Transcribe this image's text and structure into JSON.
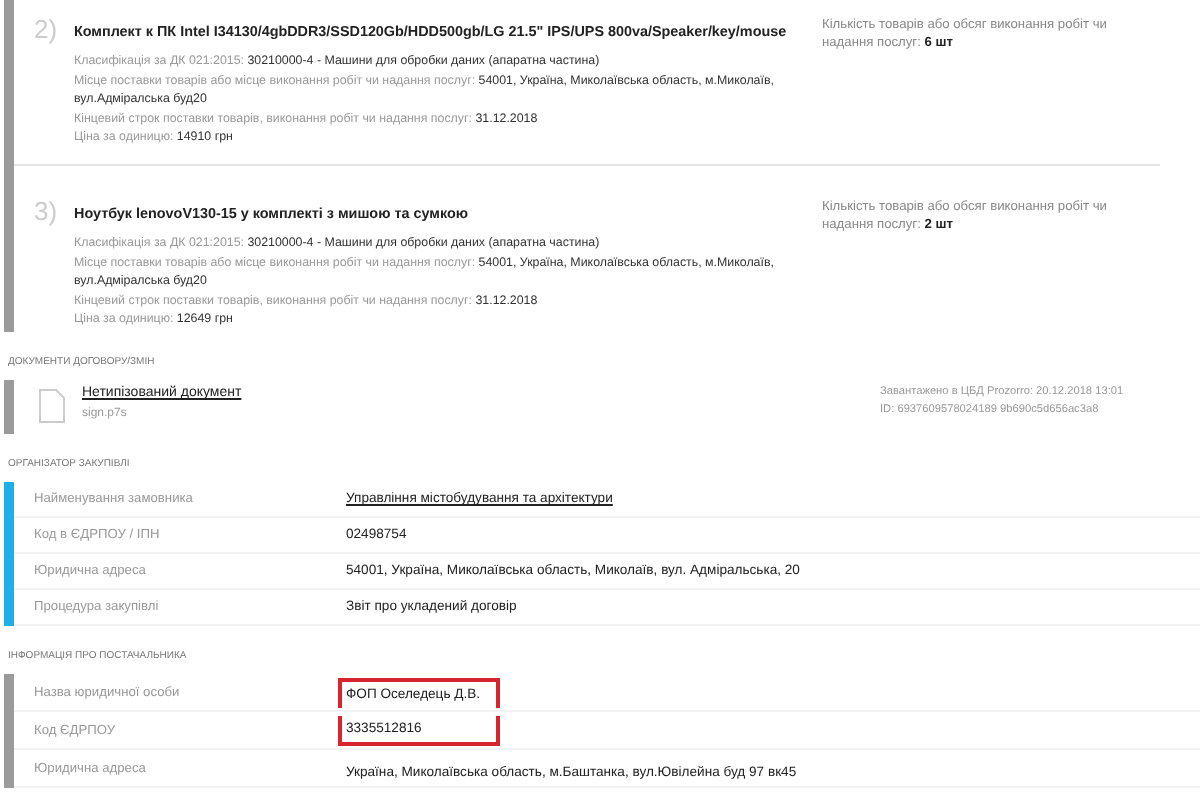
{
  "items": [
    {
      "number": "2)",
      "title": "Комплект к ПК Intel I34130/4gbDDR3/SSD120Gb/HDD500gb/LG 21.5\" IPS/UPS 800va/Speaker/key/mouse",
      "classification_label": "Класифікація за ДК 021:2015:",
      "classification": "30210000-4 - Машини для обробки даних (апаратна частина)",
      "place_label": "Місце поставки товарів або місце виконання робіт чи надання послуг:",
      "place": "54001, Україна, Миколаївська область, м.Миколаїв, вул.Адміралська буд20",
      "deadline_label": "Кінцевий строк поставки товарів, виконання робіт чи надання послуг:",
      "deadline": "31.12.2018",
      "price_label": "Ціна за одиницю:",
      "price": "14910 грн",
      "quantity_label": "Кількість товарів або обсяг виконання робіт чи надання послуг:",
      "quantity": "6 шт"
    },
    {
      "number": "3)",
      "title": "Ноутбук lenovoV130-15 у комплекті з мишою та сумкою",
      "classification_label": "Класифікація за ДК 021:2015:",
      "classification": "30210000-4 - Машини для обробки даних (апаратна частина)",
      "place_label": "Місце поставки товарів або місце виконання робіт чи надання послуг:",
      "place": "54001, Україна, Миколаївська область, м.Миколаїв, вул.Адміралська буд20",
      "deadline_label": "Кінцевий строк поставки товарів, виконання робіт чи надання послуг:",
      "deadline": "31.12.2018",
      "price_label": "Ціна за одиницю:",
      "price": "12649 грн",
      "quantity_label": "Кількість товарів або обсяг виконання робіт чи надання послуг:",
      "quantity": "2 шт"
    }
  ],
  "documents": {
    "heading": "ДОКУМЕНТИ ДОГОВОРУ/ЗМІН",
    "files": [
      {
        "title": "Нетипізований документ",
        "filename": "sign.p7s",
        "uploaded": "Завантажено в ЦБД Prozorro: 20.12.2018 13:01",
        "id": "ID: 6937609578024189 9b690c5d656ac3a8"
      }
    ]
  },
  "organizer": {
    "heading": "ОРГАНІЗАТОР ЗАКУПІВЛІ",
    "rows": [
      {
        "label": "Найменування замовника",
        "value": "Управління містобудування та архітектури",
        "kind": "link"
      },
      {
        "label": "Код в ЄДРПОУ / ІПН",
        "value": "02498754",
        "kind": "text"
      },
      {
        "label": "Юридична адреса",
        "value": "54001, Україна, Миколаївська область, Миколаїв, вул. Адміральська, 20",
        "kind": "text"
      },
      {
        "label": "Процедура закупівлі",
        "value": "Звіт про укладений договір",
        "kind": "text"
      }
    ]
  },
  "supplier": {
    "heading": "ІНФОРМАЦІЯ ПРО ПОСТАЧАЛЬНИКА",
    "rows": [
      {
        "label": "Назва юридичної особи",
        "value": "ФОП Оселедець Д.В.",
        "highlighted": true
      },
      {
        "label": "Код ЄДРПОУ",
        "value": "3335512816",
        "highlighted": true
      },
      {
        "label": "Юридична адреса",
        "value": "Україна, Миколаївська область, м.Баштанка, вул.Ювілейна буд 97 вк45",
        "highlighted": false
      }
    ]
  }
}
